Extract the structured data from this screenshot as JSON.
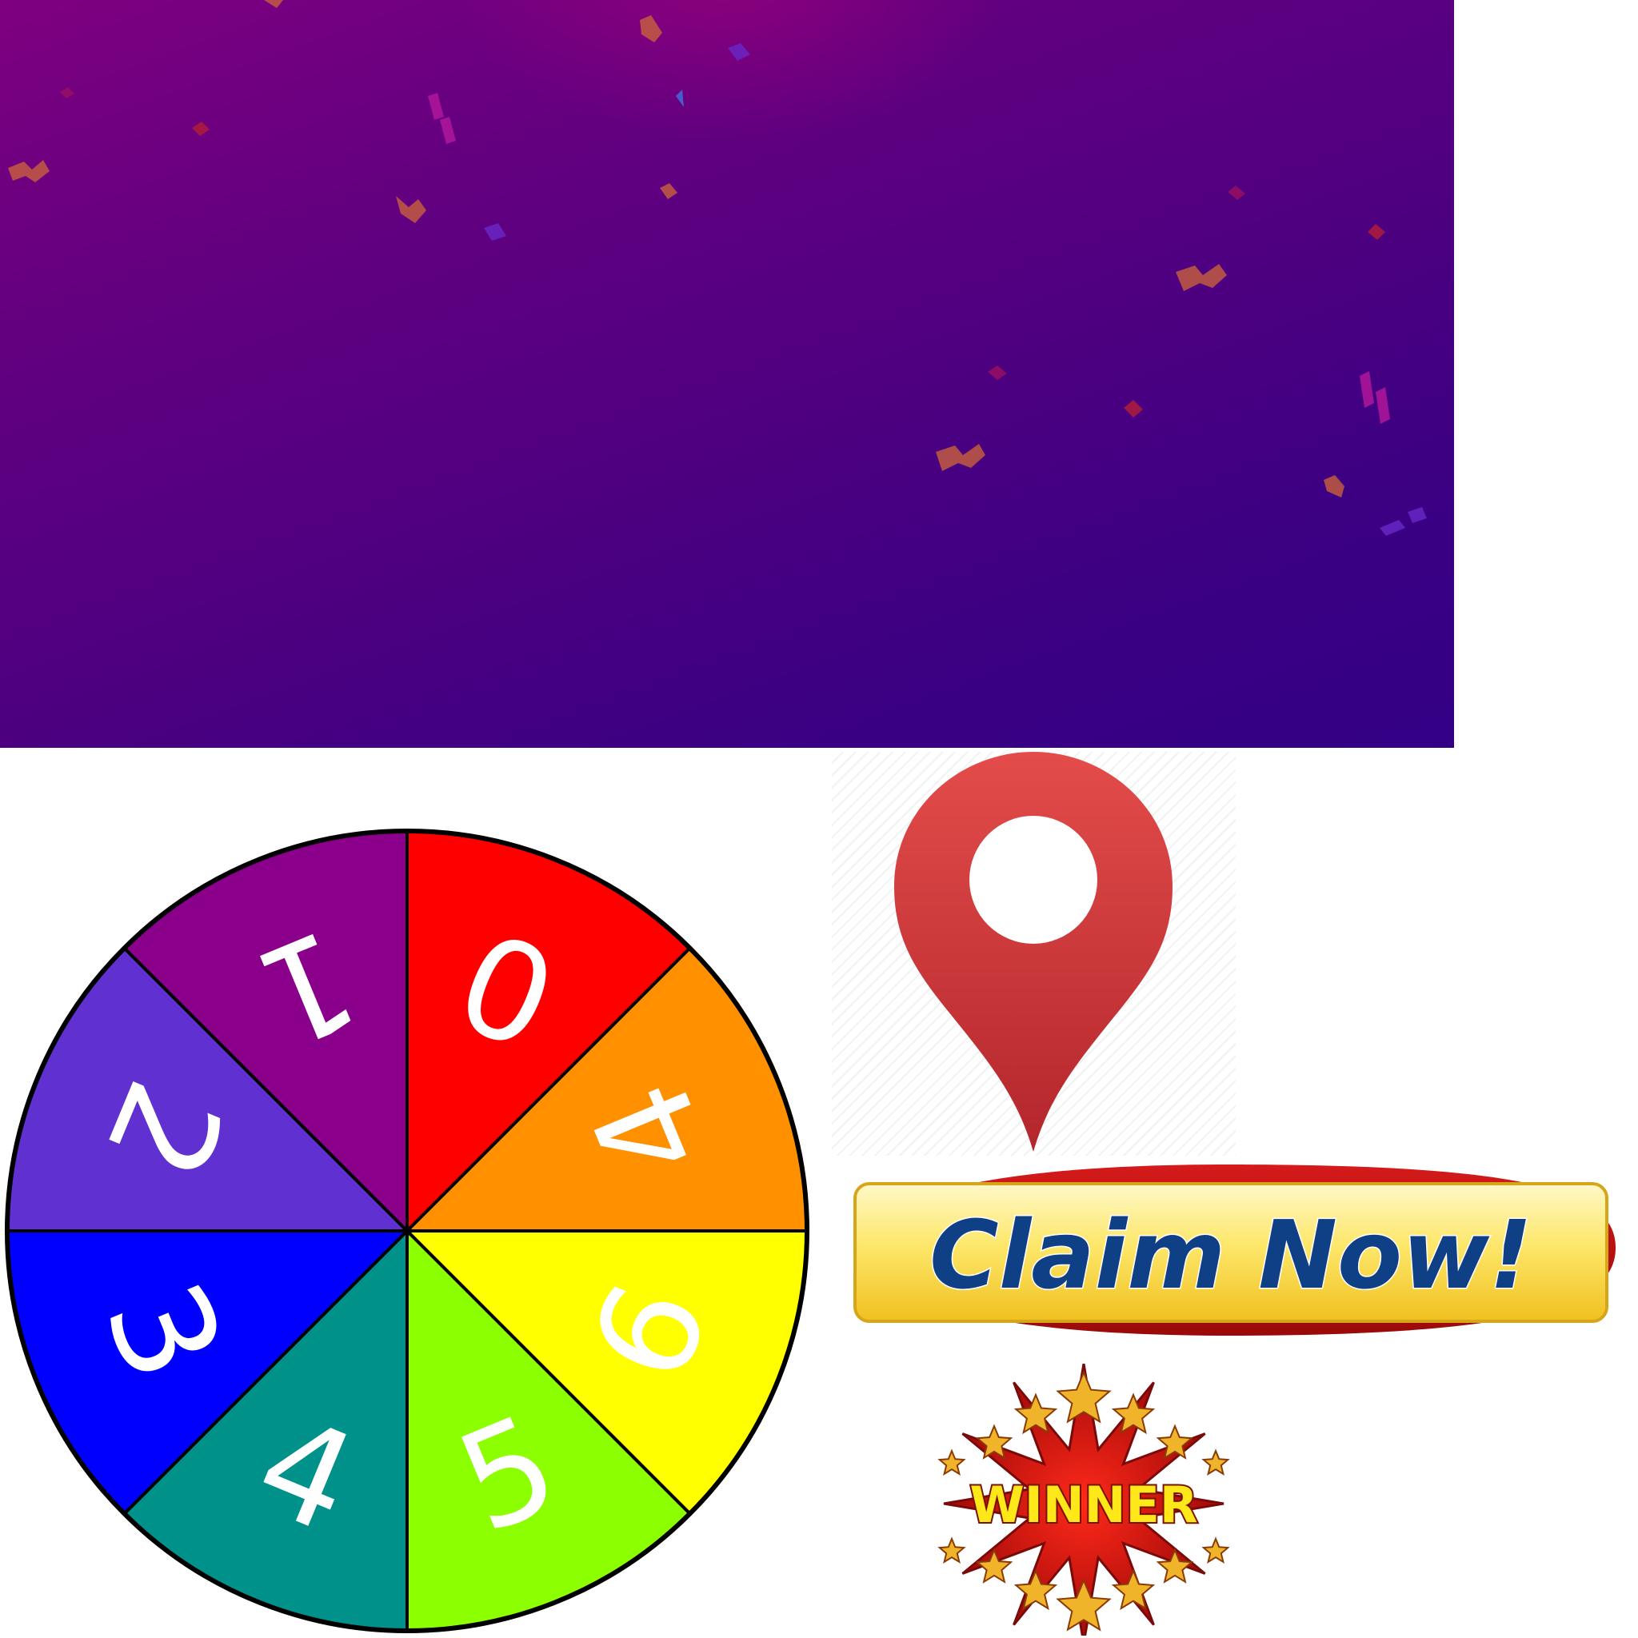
{
  "colors": {
    "banner_start": "#7e0080",
    "banner_end": "#330085",
    "wheel_outline": "#000000",
    "pin_red": "#d9383a",
    "claim_yellow": "#f7d335",
    "claim_text": "#0f3f85",
    "claim_ribbon": "#c10e0e",
    "winner_text": "#ffe81a"
  },
  "wheel": {
    "segments": [
      {
        "label": "0",
        "color": "#ff0000"
      },
      {
        "label": "4",
        "color": "#ff9000"
      },
      {
        "label": "6",
        "color": "#ffff00"
      },
      {
        "label": "5",
        "color": "#8cff00"
      },
      {
        "label": "4",
        "color": "#00918b"
      },
      {
        "label": "3",
        "color": "#0000ff"
      },
      {
        "label": "2",
        "color": "#6030d0"
      },
      {
        "label": "1",
        "color": "#8a008a"
      }
    ]
  },
  "pin": {
    "icon": "map-pin-icon"
  },
  "claim_button": {
    "label": "Claim Now!"
  },
  "winner_badge": {
    "label": "WINNER",
    "icon": "star-burst-icon"
  }
}
